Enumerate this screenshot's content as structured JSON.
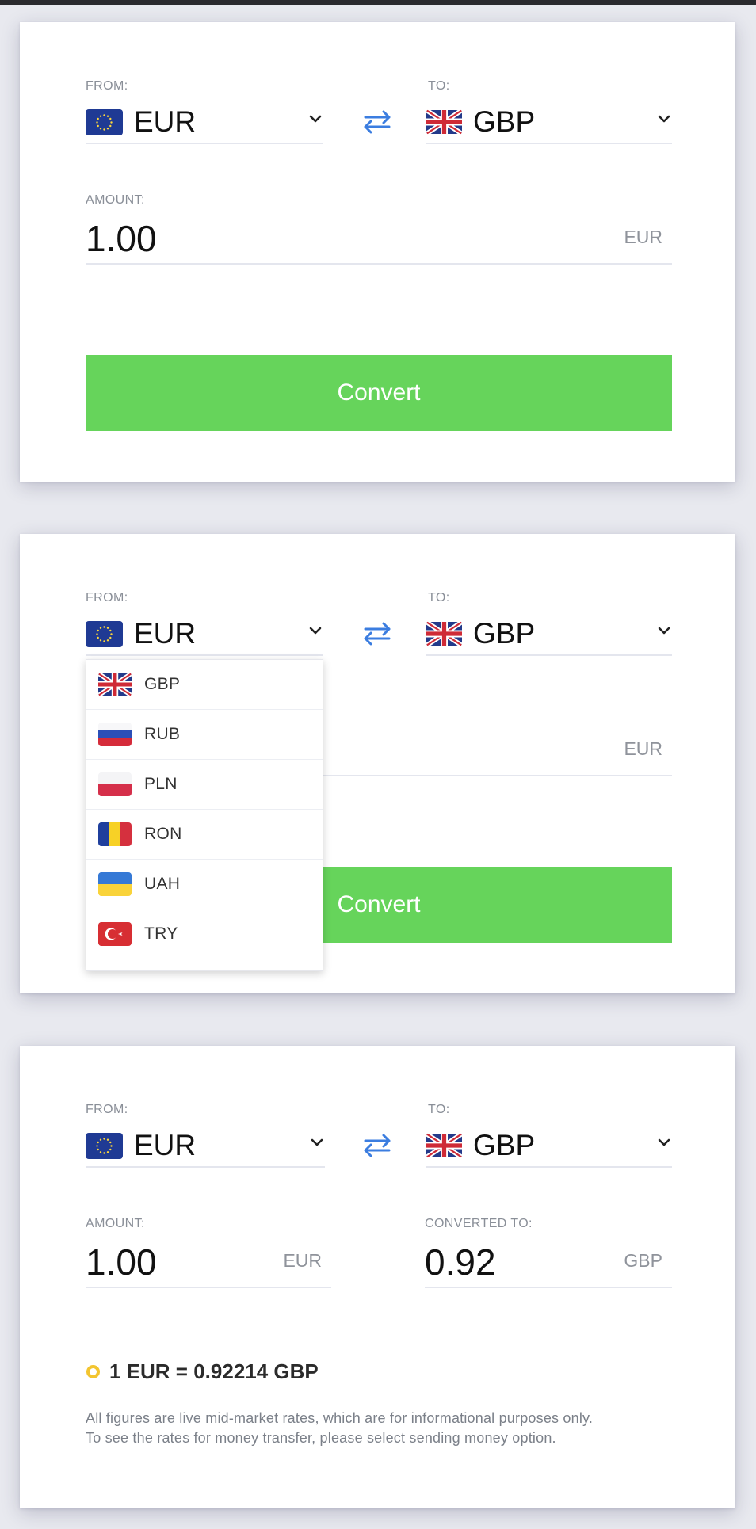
{
  "icons": {
    "eu_flag": "eu-flag-icon",
    "uk_flag": "uk-flag-icon",
    "swap": "swap-arrows-icon",
    "chevron": "chevron-down-icon"
  },
  "colors": {
    "convert_button": "#66d45b",
    "swap_icon": "#3b7de0",
    "rate_indicator": "#f3c530"
  },
  "card1": {
    "from_label": "FROM:",
    "from_currency": "EUR",
    "to_label": "TO:",
    "to_currency": "GBP",
    "amount_label": "AMOUNT:",
    "amount_value": "1.00",
    "amount_unit": "EUR",
    "convert_label": "Convert"
  },
  "card2": {
    "from_label": "FROM:",
    "from_currency": "EUR",
    "to_label": "TO:",
    "to_currency": "GBP",
    "amount_unit": "EUR",
    "convert_label": "Convert",
    "dropdown_options": [
      {
        "code": "GBP",
        "flag": "uk-flag-icon"
      },
      {
        "code": "RUB",
        "flag": "russia-flag-icon"
      },
      {
        "code": "PLN",
        "flag": "poland-flag-icon"
      },
      {
        "code": "RON",
        "flag": "romania-flag-icon"
      },
      {
        "code": "UAH",
        "flag": "ukraine-flag-icon"
      },
      {
        "code": "TRY",
        "flag": "turkey-flag-icon"
      }
    ]
  },
  "card3": {
    "from_label": "FROM:",
    "from_currency": "EUR",
    "to_label": "TO:",
    "to_currency": "GBP",
    "amount_label": "AMOUNT:",
    "amount_value": "1.00",
    "amount_unit": "EUR",
    "converted_label": "CONVERTED TO:",
    "converted_value": "0.92",
    "converted_unit": "GBP",
    "rate_text": "1 EUR = 0.92214 GBP",
    "disclaimer_line1": "All figures are live mid-market rates, which are for informational purposes only.",
    "disclaimer_line2": "To see the rates for money transfer, please select sending money option."
  }
}
